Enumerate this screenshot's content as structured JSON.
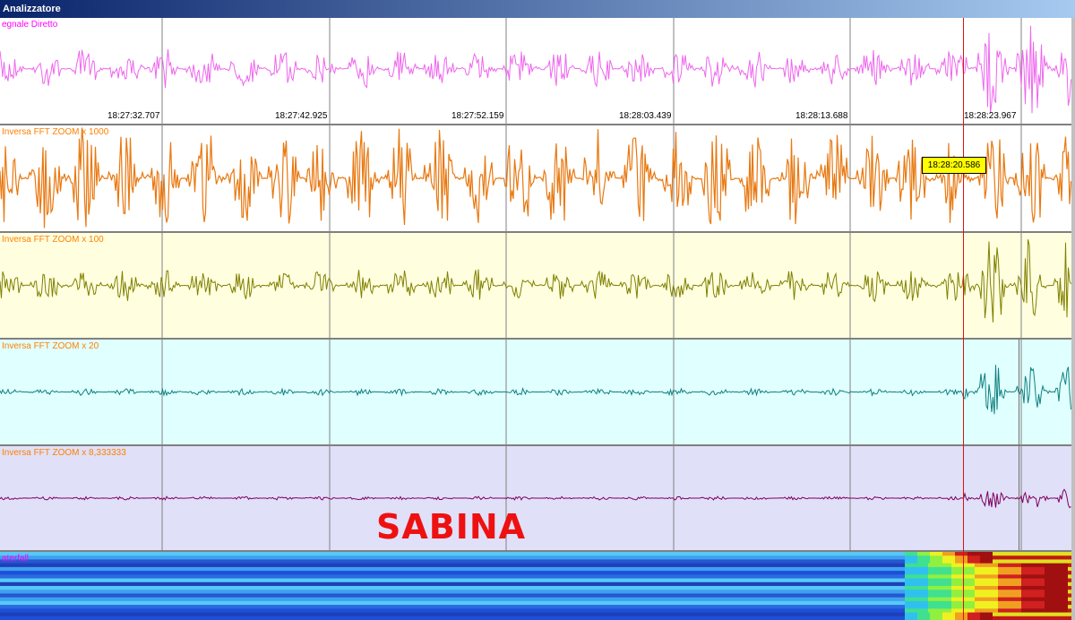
{
  "window": {
    "title": "Analizzatore"
  },
  "panels": [
    {
      "label": "egnale Diretto",
      "label_color": "#ff00ff",
      "bg": "#ffffff",
      "trace_color": "#ee66ee"
    },
    {
      "label": "Inversa FFT ZOOM x 1000",
      "label_color": "#ff8000",
      "bg": "#ffffff",
      "trace_color": "#e87810"
    },
    {
      "label": "Inversa FFT ZOOM x 100",
      "label_color": "#ff8000",
      "bg": "#ffffe0",
      "trace_color": "#808000"
    },
    {
      "label": "Inversa FFT ZOOM x 20",
      "label_color": "#ff8000",
      "bg": "#e0ffff",
      "trace_color": "#108080"
    },
    {
      "label": "Inversa FFT ZOOM x 8,333333",
      "label_color": "#ff8000",
      "bg": "#e0e0f8",
      "trace_color": "#800060"
    },
    {
      "label": "aterfall",
      "label_color": "#ff00ff",
      "bg": "#2050d0",
      "trace_color": "#20a0ff"
    }
  ],
  "time_ticks": [
    "18:27:32.707",
    "18:27:42.925",
    "18:27:52.159",
    "18:28:03.439",
    "18:28:13.688",
    "18:28:23.967"
  ],
  "cursor_time": "18:28:20.586",
  "watermark_text": "SABINA",
  "colors": {
    "marker": "#e01010",
    "tooltip_bg": "#ffff00"
  }
}
